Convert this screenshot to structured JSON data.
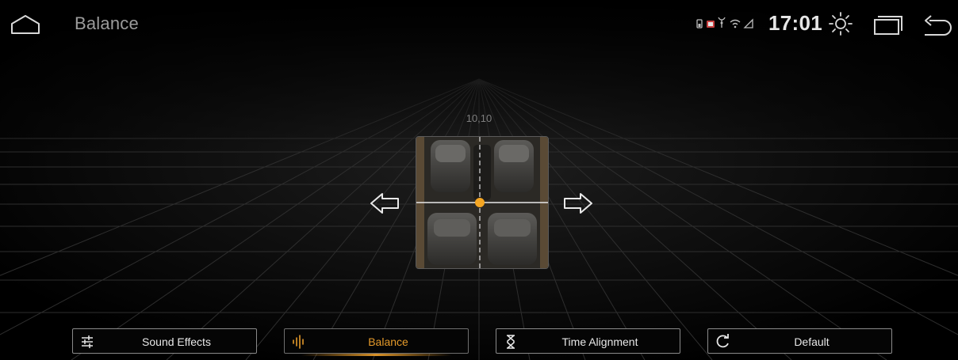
{
  "header": {
    "title": "Balance",
    "time": "17:01",
    "icons": [
      "home-icon",
      "status-icons",
      "brightness-icon",
      "recents-icon",
      "back-icon"
    ]
  },
  "balance": {
    "coordinates": "10,10",
    "left_arrow_icon": "arrow-left-icon",
    "right_arrow_icon": "arrow-right-icon",
    "accent": "#f5a623"
  },
  "tabs": [
    {
      "label": "Sound Effects",
      "icon": "equalizer-icon",
      "active": false
    },
    {
      "label": "Balance",
      "icon": "waveform-icon",
      "active": true
    },
    {
      "label": "Time Alignment",
      "icon": "hourglass-icon",
      "active": false
    },
    {
      "label": "Default",
      "icon": "reset-icon",
      "active": false
    }
  ],
  "colors": {
    "background": "#000000",
    "accent": "#e59a2a",
    "text": "#e8e8e8"
  }
}
